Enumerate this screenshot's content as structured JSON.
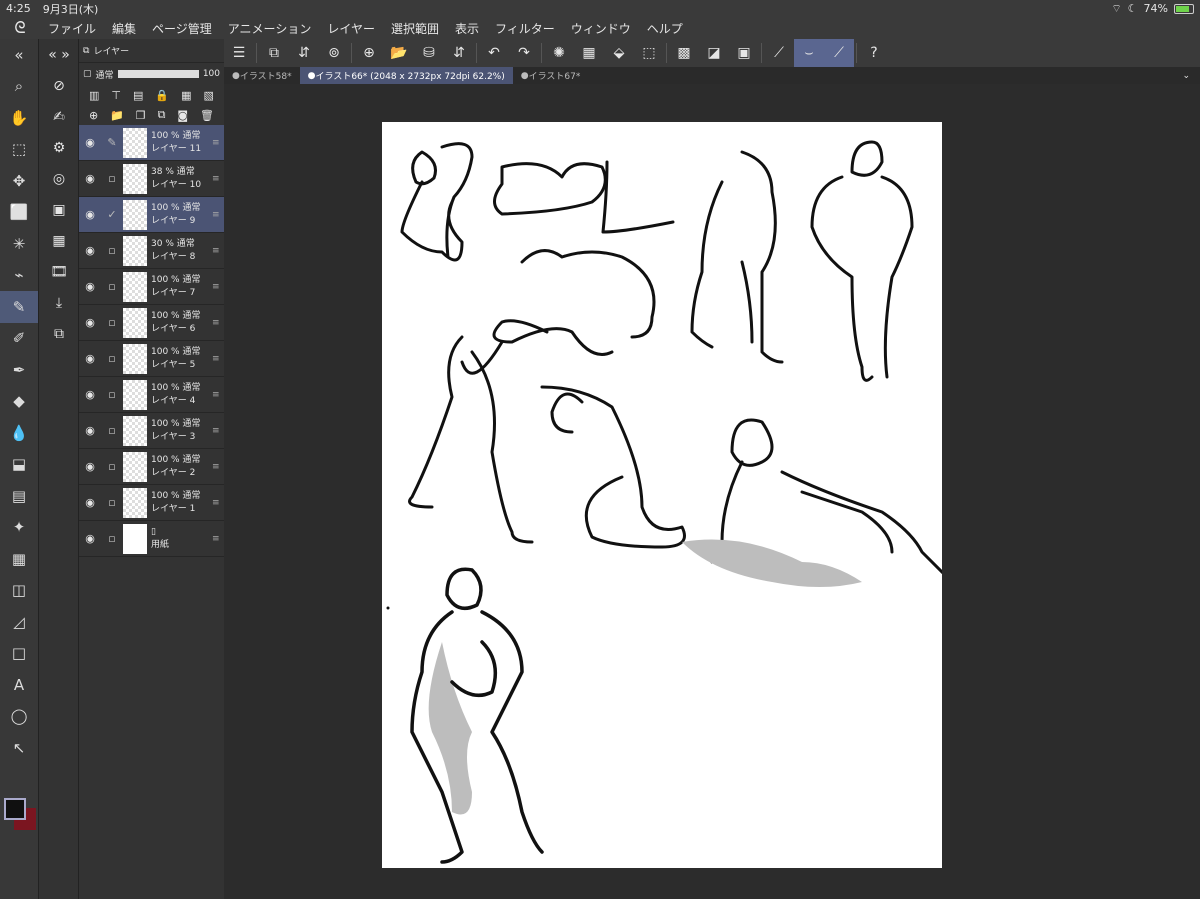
{
  "status": {
    "time": "4:25",
    "date": "9月3日(木)",
    "battery": "74%"
  },
  "menu": [
    "ファイル",
    "編集",
    "ページ管理",
    "アニメーション",
    "レイヤー",
    "選択範囲",
    "表示",
    "フィルター",
    "ウィンドウ",
    "ヘルプ"
  ],
  "layer_panel": {
    "title": "レイヤー",
    "blend": "通常",
    "opacity": "100",
    "layers": [
      {
        "opacity": "100 %",
        "mode": "通常",
        "name": "レイヤー 11",
        "selected": true
      },
      {
        "opacity": "38 %",
        "mode": "通常",
        "name": "レイヤー 10",
        "selected": false
      },
      {
        "opacity": "100 %",
        "mode": "通常",
        "name": "レイヤー 9",
        "selected": true
      },
      {
        "opacity": "30 %",
        "mode": "通常",
        "name": "レイヤー 8",
        "selected": false
      },
      {
        "opacity": "100 %",
        "mode": "通常",
        "name": "レイヤー 7",
        "selected": false
      },
      {
        "opacity": "100 %",
        "mode": "通常",
        "name": "レイヤー 6",
        "selected": false
      },
      {
        "opacity": "100 %",
        "mode": "通常",
        "name": "レイヤー 5",
        "selected": false
      },
      {
        "opacity": "100 %",
        "mode": "通常",
        "name": "レイヤー 4",
        "selected": false
      },
      {
        "opacity": "100 %",
        "mode": "通常",
        "name": "レイヤー 3",
        "selected": false
      },
      {
        "opacity": "100 %",
        "mode": "通常",
        "name": "レイヤー 2",
        "selected": false
      },
      {
        "opacity": "100 %",
        "mode": "通常",
        "name": "レイヤー 1",
        "selected": false
      }
    ],
    "paper_layer": "用紙"
  },
  "tabs": [
    {
      "label": "イラスト58*",
      "active": false
    },
    {
      "label": "イラスト66* (2048 x 2732px 72dpi 62.2%)",
      "active": true
    },
    {
      "label": "イラスト67*",
      "active": false
    }
  ],
  "colors": {
    "main": "#101010",
    "sub": "#7b1520",
    "accent": "#4b5474"
  }
}
